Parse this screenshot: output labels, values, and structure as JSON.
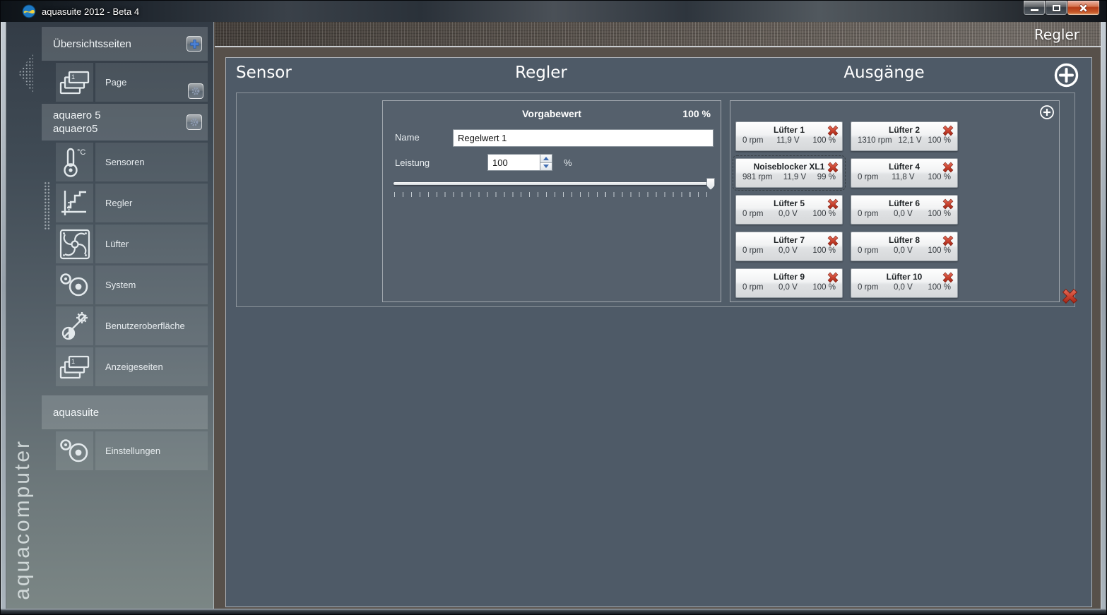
{
  "window": {
    "title": "aquasuite 2012 - Beta 4",
    "minimize_label": "minimize",
    "maximize_label": "maximize",
    "close_label": "close"
  },
  "topbar": {
    "page_title": "Regler"
  },
  "sidebar": {
    "overview": {
      "title": "Übersichtsseiten",
      "page": {
        "label": "Page",
        "icon": "pages-icon"
      }
    },
    "device": {
      "name": "aquaero 5",
      "id": "aquaero5",
      "items": [
        {
          "label": "Sensoren",
          "icon": "thermometer-icon"
        },
        {
          "label": "Regler",
          "icon": "step-chart-icon",
          "selected": true
        },
        {
          "label": "Lüfter",
          "icon": "fan-icon"
        },
        {
          "label": "System",
          "icon": "gears-icon"
        },
        {
          "label": "Benutzeroberfläche",
          "icon": "display-contrast-icon"
        },
        {
          "label": "Anzeigeseiten",
          "icon": "pages-icon"
        }
      ]
    },
    "app": {
      "title": "aquasuite",
      "items": [
        {
          "label": "Einstellungen",
          "icon": "gears-icon"
        }
      ]
    },
    "brand": "aquacomputer"
  },
  "main": {
    "columns": {
      "sensor": "Sensor",
      "regler": "Regler",
      "outputs": "Ausgänge"
    },
    "preset": {
      "title": "Vorgabewert",
      "current": "100 %",
      "name_label": "Name",
      "name_value": "Regelwert 1",
      "power_label": "Leistung",
      "power_value": "100",
      "power_unit": "%"
    },
    "outputs": [
      {
        "name": "Lüfter 1",
        "rpm": "0 rpm",
        "voltage": "11,9 V",
        "power": "100 %"
      },
      {
        "name": "Lüfter 2",
        "rpm": "1310 rpm",
        "voltage": "12,1 V",
        "power": "100 %"
      },
      {
        "name": "Noiseblocker XL1",
        "rpm": "981 rpm",
        "voltage": "11,9 V",
        "power": "99 %",
        "selected": true
      },
      {
        "name": "Lüfter 4",
        "rpm": "0 rpm",
        "voltage": "11,8 V",
        "power": "100 %"
      },
      {
        "name": "Lüfter 5",
        "rpm": "0 rpm",
        "voltage": "0,0 V",
        "power": "100 %"
      },
      {
        "name": "Lüfter 6",
        "rpm": "0 rpm",
        "voltage": "0,0 V",
        "power": "100 %"
      },
      {
        "name": "Lüfter 7",
        "rpm": "0 rpm",
        "voltage": "0,0 V",
        "power": "100 %"
      },
      {
        "name": "Lüfter 8",
        "rpm": "0 rpm",
        "voltage": "0,0 V",
        "power": "100 %"
      },
      {
        "name": "Lüfter 9",
        "rpm": "0 rpm",
        "voltage": "0,0 V",
        "power": "100 %"
      },
      {
        "name": "Lüfter 10",
        "rpm": "0 rpm",
        "voltage": "0,0 V",
        "power": "100 %"
      }
    ]
  },
  "colors": {
    "accent_red": "#c23725",
    "accent_blue": "#4d82d6",
    "panel_slate": "#4e5a67",
    "frame_brown": "#57504a"
  }
}
